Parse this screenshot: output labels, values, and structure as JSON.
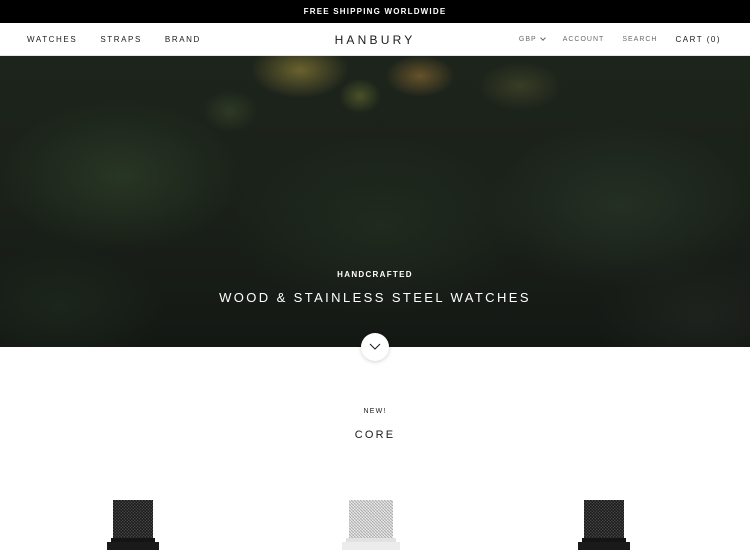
{
  "announcement": {
    "text": "FREE SHIPPING WORLDWIDE"
  },
  "header": {
    "nav_left": [
      "WATCHES",
      "STRAPS",
      "BRAND"
    ],
    "logo": "HANBURY",
    "currency": "GBP",
    "account": "ACCOUNT",
    "search": "SEARCH",
    "cart": "CART (0)"
  },
  "hero": {
    "subheading": "HANDCRAFTED",
    "heading": "WOOD & STAINLESS STEEL WATCHES",
    "scroll_icon": "chevron-down-icon"
  },
  "collection": {
    "tag": "NEW!",
    "title": "CORE"
  },
  "products": [
    {
      "icon": "watch-black-mesh-icon",
      "strap_color": "#2a2a2a",
      "case_color": "#141414"
    },
    {
      "icon": "watch-silver-mesh-icon",
      "strap_color": "#c9c9c9",
      "case_color": "#e2e2e2"
    },
    {
      "icon": "watch-black-mesh-icon",
      "strap_color": "#2a2a2a",
      "case_color": "#141414"
    }
  ],
  "colors": {
    "announcement_bg": "#000000",
    "text_dark": "#1c1b1b",
    "text_muted": "#6a6a6a"
  }
}
